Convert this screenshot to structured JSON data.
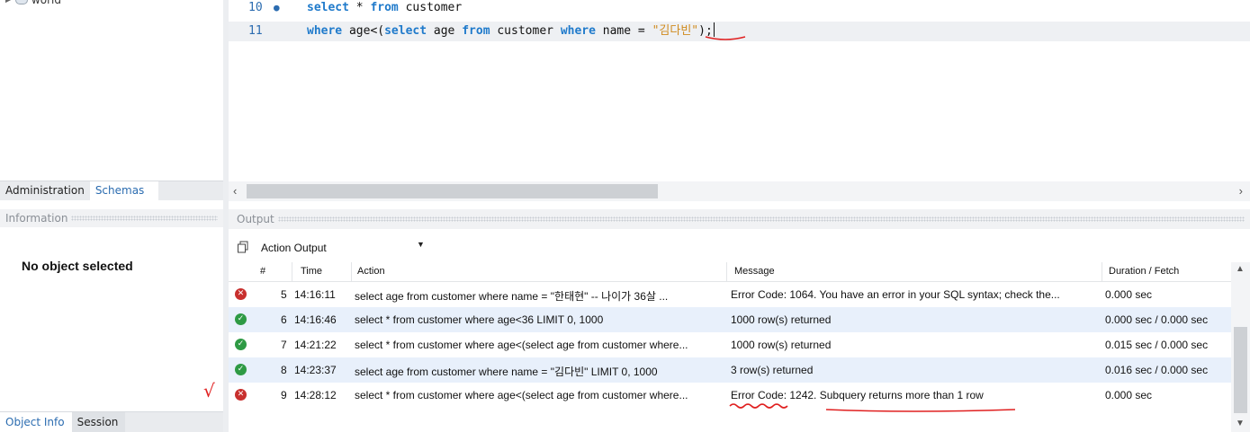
{
  "sidebar": {
    "tree_item_label": "world",
    "tabs": [
      {
        "label": "Administration"
      },
      {
        "label": "Schemas"
      }
    ],
    "info_header": "Information",
    "no_object_text": "No object selected",
    "annotation_mark": "√",
    "bottom_tabs": [
      {
        "label": "Object Info"
      },
      {
        "label": "Session"
      }
    ]
  },
  "editor": {
    "lines": [
      {
        "number": "10",
        "marker": "●",
        "kw1": "select",
        "rest": " * ",
        "kw2": "from",
        "tail": " customer"
      },
      {
        "number": "11",
        "kw1": "where",
        "p1": " age<(",
        "kw2": "select",
        "p2": " age ",
        "kw3": "from",
        "p3": " customer ",
        "kw4": "where",
        "p4": " name = ",
        "str": "\"김다빈\"",
        "p5": ");"
      }
    ]
  },
  "output": {
    "header": "Output",
    "selector_value": "Action Output",
    "columns": [
      "#",
      "Time",
      "Action",
      "Message",
      "Duration / Fetch"
    ],
    "rows": [
      {
        "status": "error",
        "num": "5",
        "time": "14:16:11",
        "action": "select age from customer where name = \"한태현\" -- 나이가 36살 ...",
        "message": "Error Code: 1064. You have an error in your SQL syntax; check the...",
        "duration": "0.000 sec"
      },
      {
        "status": "ok",
        "num": "6",
        "time": "14:16:46",
        "action": "select * from customer where age<36 LIMIT 0, 1000",
        "message": "1000 row(s) returned",
        "duration": "0.000 sec / 0.000 sec"
      },
      {
        "status": "ok",
        "num": "7",
        "time": "14:21:22",
        "action": "select * from customer where age<(select age from customer where...",
        "message": "1000 row(s) returned",
        "duration": "0.015 sec / 0.000 sec"
      },
      {
        "status": "ok",
        "num": "8",
        "time": "14:23:37",
        "action": "select age from customer where name = \"김다빈\" LIMIT 0, 1000",
        "message": "3 row(s) returned",
        "duration": "0.016 sec / 0.000 sec"
      },
      {
        "status": "error",
        "num": "9",
        "time": "14:28:12",
        "action": "select * from customer where age<(select age from customer where...",
        "message": "Error Code: 1242. Subquery returns more than 1 row",
        "duration": "0.000 sec"
      }
    ]
  },
  "colors": {
    "keyword": "#1f7acb",
    "string": "#d08b1f",
    "error_icon": "#c8302e",
    "ok_icon": "#2e9a44",
    "annotation": "#e02020"
  },
  "icons": {
    "tree": "database-icon",
    "copy": "copy-icon",
    "error": "error-icon",
    "ok": "success-icon"
  }
}
